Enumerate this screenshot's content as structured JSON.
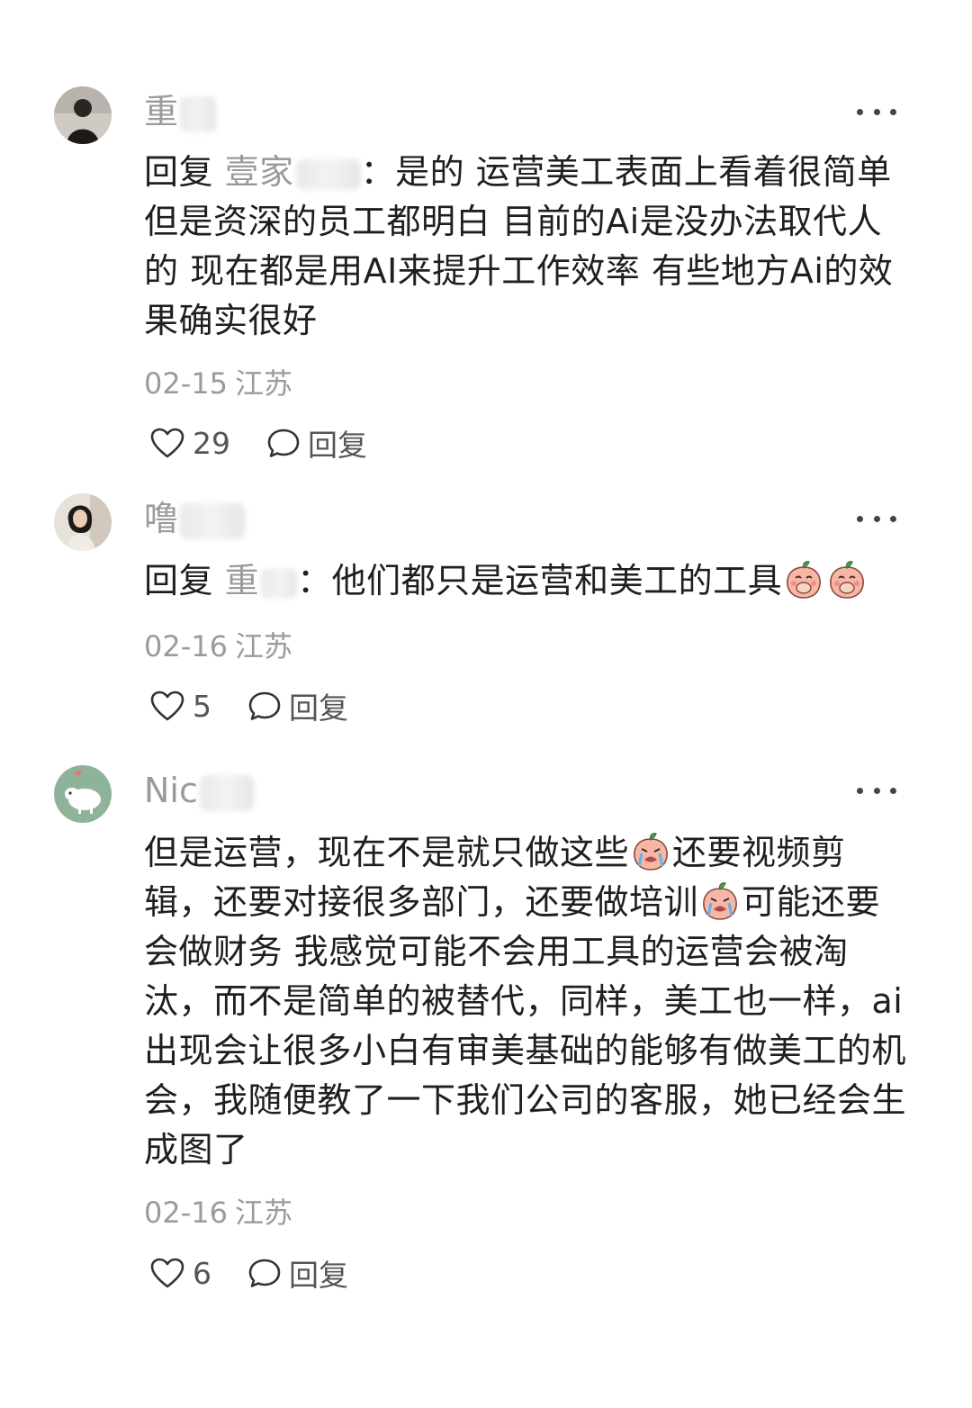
{
  "comments": [
    {
      "user": "重",
      "reply_word": "回复",
      "reply_to": "壹家",
      "separator": "：",
      "text": "是的 运营美工表面上看着很简单但是资深的员工都明白 目前的Ai是没办法取代人的 现在都是用AI来提升工作效率 有些地方Ai的效果确实很好",
      "date": "02-15",
      "location": "江苏",
      "likes": "29",
      "reply_label": "回复",
      "avatar_icon": "person-avatar"
    },
    {
      "user": "噜",
      "reply_word": "回复",
      "reply_to": "重",
      "separator": "：",
      "text": "他们都只是运营和美工的工具",
      "emoji": [
        "peach-cover-mouth-emoji",
        "peach-cover-mouth-emoji"
      ],
      "date": "02-16",
      "location": "江苏",
      "likes": "5",
      "reply_label": "回复",
      "avatar_icon": "person-avatar"
    },
    {
      "user": "Nic",
      "text_parts": [
        "但是运营，现在不是就只做这些",
        "还要视频剪辑，还要对接很多部门，还要做培训",
        "可能还要会做财务 我感觉可能不会用工具的运营会被淘汰，而不是简单的被替代，同样，美工也一样，ai 出现会让很多小白有审美基础的能够有做美工的机会，我随便教了一下我们公司的客服，她已经会生成图了"
      ],
      "emoji": [
        "peach-crying-emoji",
        "peach-crying-emoji"
      ],
      "date": "02-16",
      "location": "江苏",
      "likes": "6",
      "reply_label": "回复",
      "avatar_icon": "cartoon-avatar"
    }
  ],
  "icons": {
    "more": "more-dots-icon",
    "like": "heart-icon",
    "reply": "comment-bubble-icon"
  },
  "colors": {
    "muted_text": "#9b9b9b",
    "body_text": "#1f1f1f",
    "avatar_green": "#8fb39a"
  }
}
